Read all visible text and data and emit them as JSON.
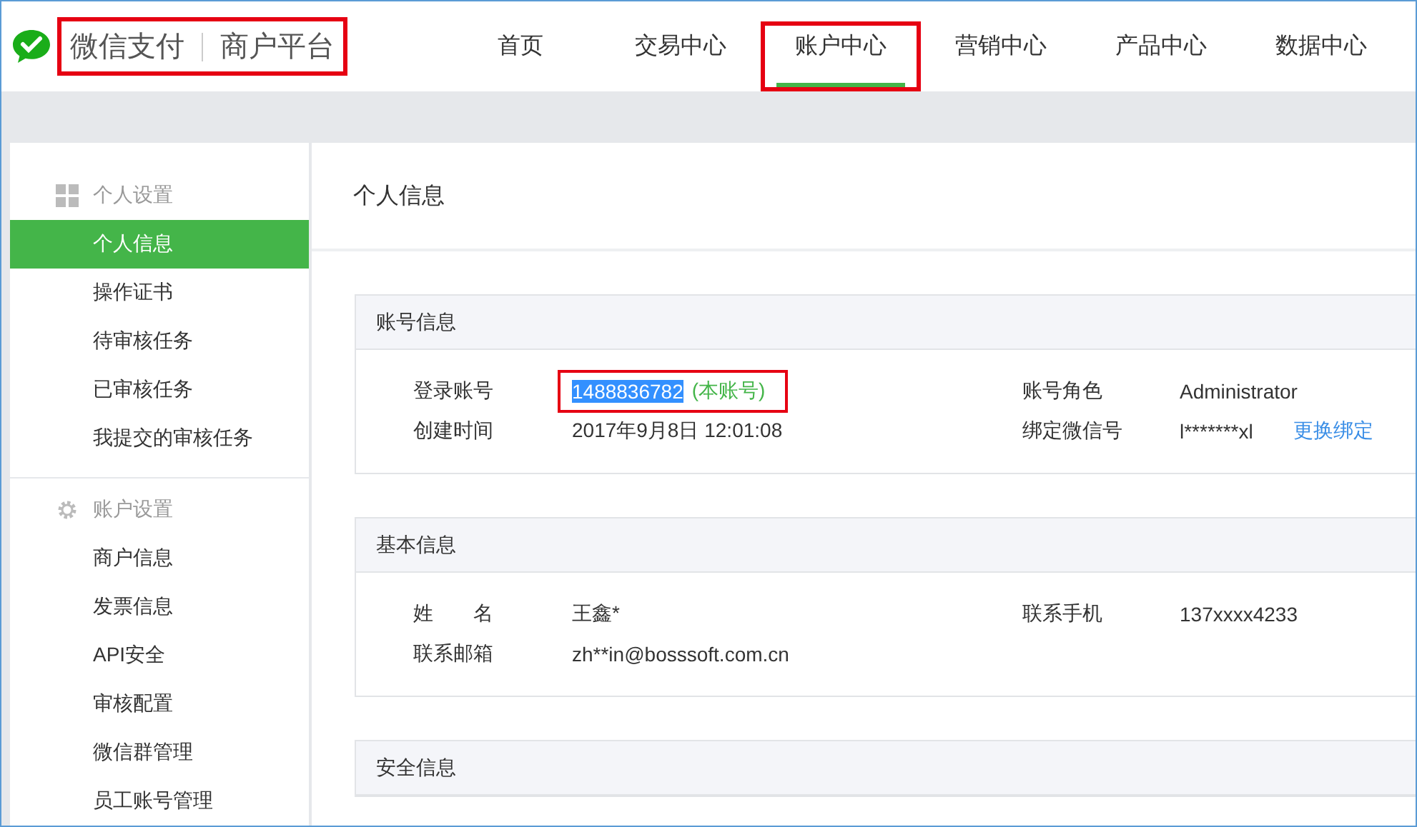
{
  "brand": {
    "title": "微信支付",
    "subtitle": "商户平台",
    "annotated": true
  },
  "nav": [
    {
      "label": "首页",
      "selected": false,
      "annotated": false
    },
    {
      "label": "交易中心",
      "selected": false,
      "annotated": false
    },
    {
      "label": "账户中心",
      "selected": true,
      "annotated": true
    },
    {
      "label": "营销中心",
      "selected": false,
      "annotated": false
    },
    {
      "label": "产品中心",
      "selected": false,
      "annotated": false
    },
    {
      "label": "数据中心",
      "selected": false,
      "annotated": false
    }
  ],
  "sidebar": [
    {
      "title": "个人设置",
      "kind": "grid",
      "items": [
        {
          "label": "个人信息",
          "selected": true
        },
        {
          "label": "操作证书",
          "selected": false
        },
        {
          "label": "待审核任务",
          "selected": false
        },
        {
          "label": "已审核任务",
          "selected": false
        },
        {
          "label": "我提交的审核任务",
          "selected": false
        }
      ]
    },
    {
      "title": "账户设置",
      "kind": "gear",
      "items": [
        {
          "label": "商户信息",
          "selected": false
        },
        {
          "label": "发票信息",
          "selected": false
        },
        {
          "label": "API安全",
          "selected": false
        },
        {
          "label": "审核配置",
          "selected": false
        },
        {
          "label": "微信群管理",
          "selected": false
        },
        {
          "label": "员工账号管理",
          "selected": false
        }
      ]
    }
  ],
  "page_title": "个人信息",
  "cards": [
    {
      "title": "账号信息",
      "fields": [
        {
          "label": "登录账号",
          "value": "1488836782",
          "note": "(本账号)",
          "text_selected": true,
          "annotated": true
        },
        {
          "label": "账号角色",
          "value": "Administrator",
          "text_selected": false,
          "annotated": false
        },
        {
          "label": "创建时间",
          "value": "2017年9月8日 12:01:08",
          "text_selected": false,
          "annotated": false
        },
        {
          "label": "绑定微信号",
          "value": "l*******xl",
          "link": "更换绑定",
          "text_selected": false,
          "annotated": false
        }
      ]
    },
    {
      "title": "基本信息",
      "fields": [
        {
          "label": "姓　　名",
          "value": "王鑫*",
          "text_selected": false,
          "annotated": false
        },
        {
          "label": "联系手机",
          "value": "137xxxx4233",
          "text_selected": false,
          "annotated": false
        },
        {
          "label": "联系邮箱",
          "value": "zh**in@bosssoft.com.cn",
          "text_selected": false,
          "annotated": false
        }
      ]
    },
    {
      "title": "安全信息"
    }
  ]
}
